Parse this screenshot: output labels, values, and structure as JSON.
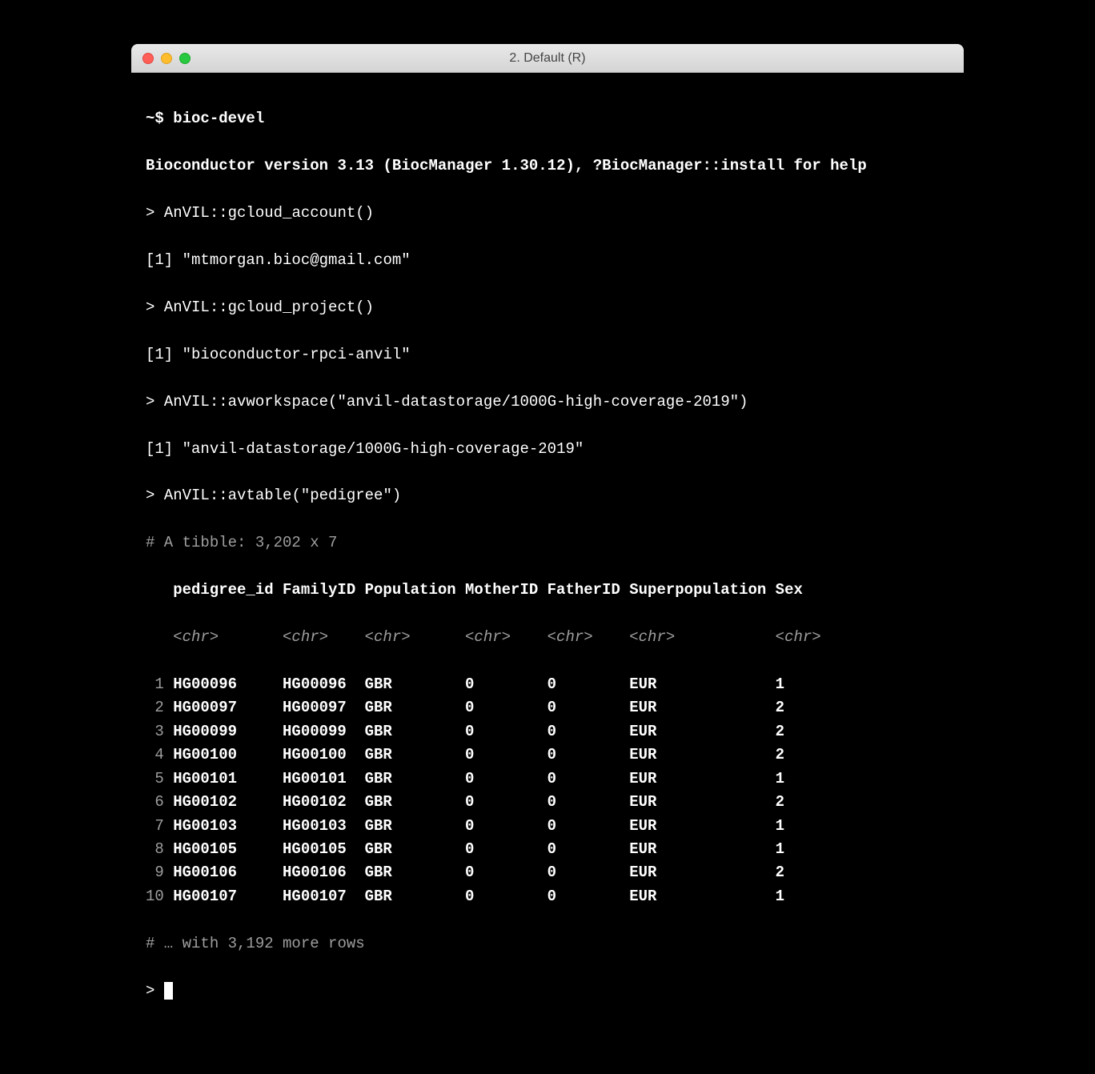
{
  "window": {
    "title": "2. Default (R)"
  },
  "prompt": {
    "ps1": "~$ ",
    "R": "> "
  },
  "lines": {
    "l1_cmd": "bioc-devel",
    "l2_banner": "Bioconductor version 3.13 (BiocManager 1.30.12), ?BiocManager::install for help",
    "l3_cmd": "AnVIL::gcloud_account()",
    "l4_out": "[1] \"mtmorgan.bioc@gmail.com\"",
    "l5_cmd": "AnVIL::gcloud_project()",
    "l6_out": "[1] \"bioconductor-rpci-anvil\"",
    "l7_cmd": "AnVIL::avworkspace(\"anvil-datastorage/1000G-high-coverage-2019\")",
    "l8_out": "[1] \"anvil-datastorage/1000G-high-coverage-2019\"",
    "l9_cmd": "AnVIL::avtable(\"pedigree\")"
  },
  "tibble": {
    "summary": "# A tibble: 3,202 x 7",
    "footer": "# … with 3,192 more rows",
    "columns": [
      "pedigree_id",
      "FamilyID",
      "Population",
      "MotherID",
      "FatherID",
      "Superpopulation",
      "Sex"
    ],
    "types": [
      "<chr>",
      "<chr>",
      "<chr>",
      "<chr>",
      "<chr>",
      "<chr>",
      "<chr>"
    ],
    "rows": [
      {
        "n": "1",
        "pedigree_id": "HG00096",
        "FamilyID": "HG00096",
        "Population": "GBR",
        "MotherID": "0",
        "FatherID": "0",
        "Superpopulation": "EUR",
        "Sex": "1"
      },
      {
        "n": "2",
        "pedigree_id": "HG00097",
        "FamilyID": "HG00097",
        "Population": "GBR",
        "MotherID": "0",
        "FatherID": "0",
        "Superpopulation": "EUR",
        "Sex": "2"
      },
      {
        "n": "3",
        "pedigree_id": "HG00099",
        "FamilyID": "HG00099",
        "Population": "GBR",
        "MotherID": "0",
        "FatherID": "0",
        "Superpopulation": "EUR",
        "Sex": "2"
      },
      {
        "n": "4",
        "pedigree_id": "HG00100",
        "FamilyID": "HG00100",
        "Population": "GBR",
        "MotherID": "0",
        "FatherID": "0",
        "Superpopulation": "EUR",
        "Sex": "2"
      },
      {
        "n": "5",
        "pedigree_id": "HG00101",
        "FamilyID": "HG00101",
        "Population": "GBR",
        "MotherID": "0",
        "FatherID": "0",
        "Superpopulation": "EUR",
        "Sex": "1"
      },
      {
        "n": "6",
        "pedigree_id": "HG00102",
        "FamilyID": "HG00102",
        "Population": "GBR",
        "MotherID": "0",
        "FatherID": "0",
        "Superpopulation": "EUR",
        "Sex": "2"
      },
      {
        "n": "7",
        "pedigree_id": "HG00103",
        "FamilyID": "HG00103",
        "Population": "GBR",
        "MotherID": "0",
        "FatherID": "0",
        "Superpopulation": "EUR",
        "Sex": "1"
      },
      {
        "n": "8",
        "pedigree_id": "HG00105",
        "FamilyID": "HG00105",
        "Population": "GBR",
        "MotherID": "0",
        "FatherID": "0",
        "Superpopulation": "EUR",
        "Sex": "1"
      },
      {
        "n": "9",
        "pedigree_id": "HG00106",
        "FamilyID": "HG00106",
        "Population": "GBR",
        "MotherID": "0",
        "FatherID": "0",
        "Superpopulation": "EUR",
        "Sex": "2"
      },
      {
        "n": "10",
        "pedigree_id": "HG00107",
        "FamilyID": "HG00107",
        "Population": "GBR",
        "MotherID": "0",
        "FatherID": "0",
        "Superpopulation": "EUR",
        "Sex": "1"
      }
    ]
  }
}
